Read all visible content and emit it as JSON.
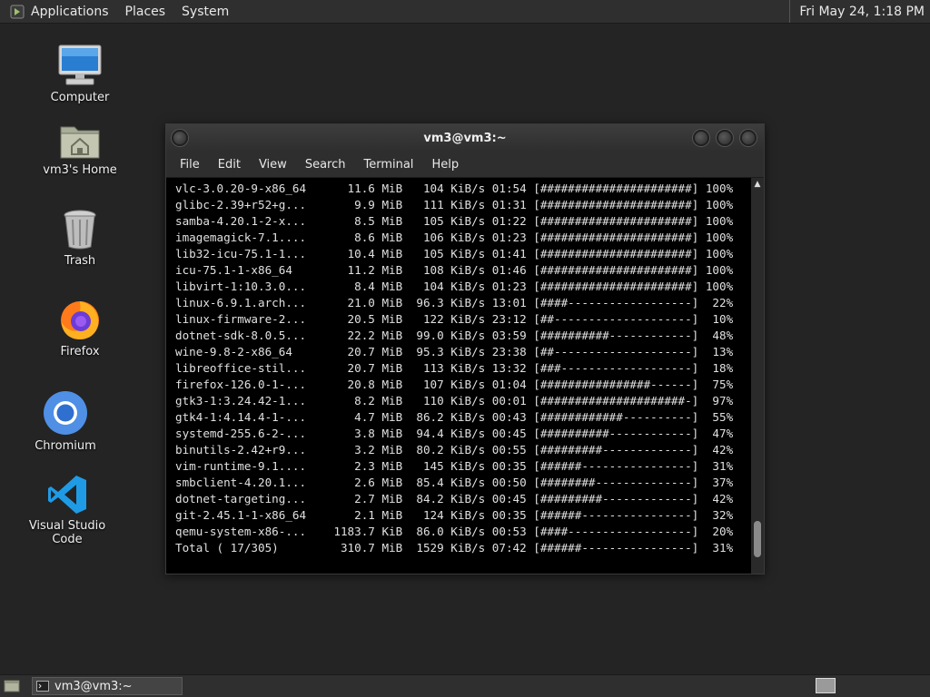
{
  "top_panel": {
    "menus": [
      "Applications",
      "Places",
      "System"
    ],
    "clock": "Fri May 24,  1:18 PM"
  },
  "desktop_icons": [
    {
      "label": "Computer",
      "icon": "computer-icon"
    },
    {
      "label": "vm3's Home",
      "icon": "home-folder-icon"
    },
    {
      "label": "Trash",
      "icon": "trash-icon"
    },
    {
      "label": "Firefox",
      "icon": "firefox-icon"
    },
    {
      "label": "Chromium",
      "icon": "chromium-icon"
    },
    {
      "label": "Visual Studio Code",
      "icon": "vscode-icon"
    }
  ],
  "window": {
    "title": "vm3@vm3:~",
    "menus": [
      "File",
      "Edit",
      "View",
      "Search",
      "Terminal",
      "Help"
    ]
  },
  "terminal_lines": [
    "vlc-3.0.20-9-x86_64      11.6 MiB   104 KiB/s 01:54 [######################] 100%",
    "glibc-2.39+r52+g...       9.9 MiB   111 KiB/s 01:31 [######################] 100%",
    "samba-4.20.1-2-x...       8.5 MiB   105 KiB/s 01:22 [######################] 100%",
    "imagemagick-7.1....       8.6 MiB   106 KiB/s 01:23 [######################] 100%",
    "lib32-icu-75.1-1...      10.4 MiB   105 KiB/s 01:41 [######################] 100%",
    "icu-75.1-1-x86_64        11.2 MiB   108 KiB/s 01:46 [######################] 100%",
    "libvirt-1:10.3.0...       8.4 MiB   104 KiB/s 01:23 [######################] 100%",
    "linux-6.9.1.arch...      21.0 MiB  96.3 KiB/s 13:01 [####------------------]  22%",
    "linux-firmware-2...      20.5 MiB   122 KiB/s 23:12 [##--------------------]  10%",
    "dotnet-sdk-8.0.5...      22.2 MiB  99.0 KiB/s 03:59 [##########------------]  48%",
    "wine-9.8-2-x86_64        20.7 MiB  95.3 KiB/s 23:38 [##--------------------]  13%",
    "libreoffice-stil...      20.7 MiB   113 KiB/s 13:32 [###-------------------]  18%",
    "firefox-126.0-1-...      20.8 MiB   107 KiB/s 01:04 [################------]  75%",
    "gtk3-1:3.24.42-1...       8.2 MiB   110 KiB/s 00:01 [#####################-]  97%",
    "gtk4-1:4.14.4-1-...       4.7 MiB  86.2 KiB/s 00:43 [############----------]  55%",
    "systemd-255.6-2-...       3.8 MiB  94.4 KiB/s 00:45 [##########------------]  47%",
    "binutils-2.42+r9...       3.2 MiB  80.2 KiB/s 00:55 [#########-------------]  42%",
    "vim-runtime-9.1....       2.3 MiB   145 KiB/s 00:35 [######----------------]  31%",
    "smbclient-4.20.1...       2.6 MiB  85.4 KiB/s 00:50 [########--------------]  37%",
    "dotnet-targeting...       2.7 MiB  84.2 KiB/s 00:45 [#########-------------]  42%",
    "git-2.45.1-1-x86_64       2.1 MiB   124 KiB/s 00:35 [######----------------]  32%",
    "qemu-system-x86-...    1183.7 KiB  86.0 KiB/s 00:53 [####------------------]  20%",
    "Total ( 17/305)         310.7 MiB  1529 KiB/s 07:42 [######----------------]  31%"
  ],
  "taskbar": {
    "window_button": "vm3@vm3:~"
  }
}
